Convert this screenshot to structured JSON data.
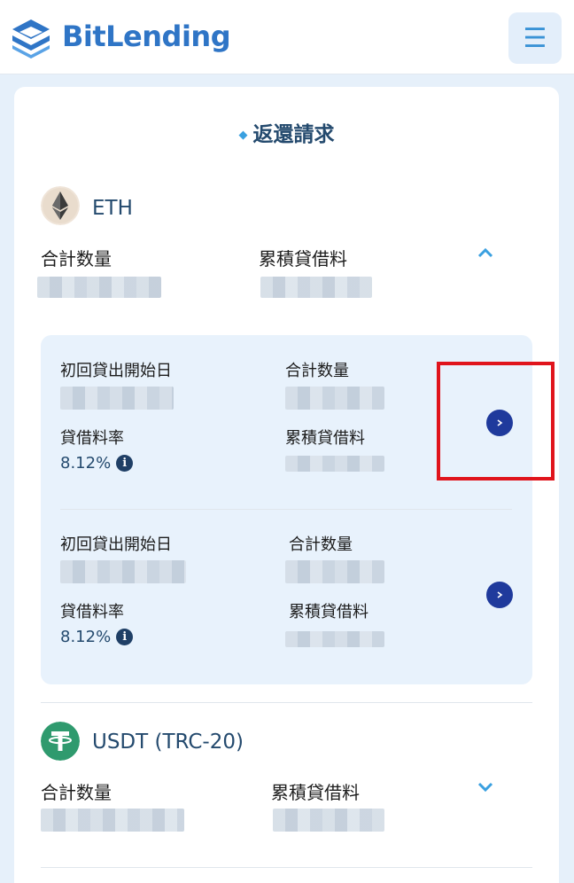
{
  "header": {
    "brand": "BitLending",
    "logo_icon": "bitlending-logo-icon",
    "menu_icon": "hamburger-menu-icon",
    "menu_glyph": "☰"
  },
  "page": {
    "title": "返還請求"
  },
  "coins": [
    {
      "name": "ETH",
      "icon": "ethereum-icon",
      "total_label": "合計数量",
      "fee_label": "累積貸借料",
      "expanded": true,
      "entries": [
        {
          "start_date_label": "初回貸出開始日",
          "total_label": "合計数量",
          "rate_label": "貸借料率",
          "rate_value": "8.12%",
          "fee_label": "累積貸借料"
        },
        {
          "start_date_label": "初回貸出開始日",
          "total_label": "合計数量",
          "rate_label": "貸借料率",
          "rate_value": "8.12%",
          "fee_label": "累積貸借料"
        }
      ]
    },
    {
      "name": "USDT (TRC-20)",
      "icon": "tether-icon",
      "total_label": "合計数量",
      "fee_label": "累積貸借料",
      "expanded": false
    }
  ],
  "colors": {
    "accent": "#3a93d6",
    "brand": "#2f75c6",
    "highlight": "#e0141c",
    "button": "#1f3a9c"
  }
}
